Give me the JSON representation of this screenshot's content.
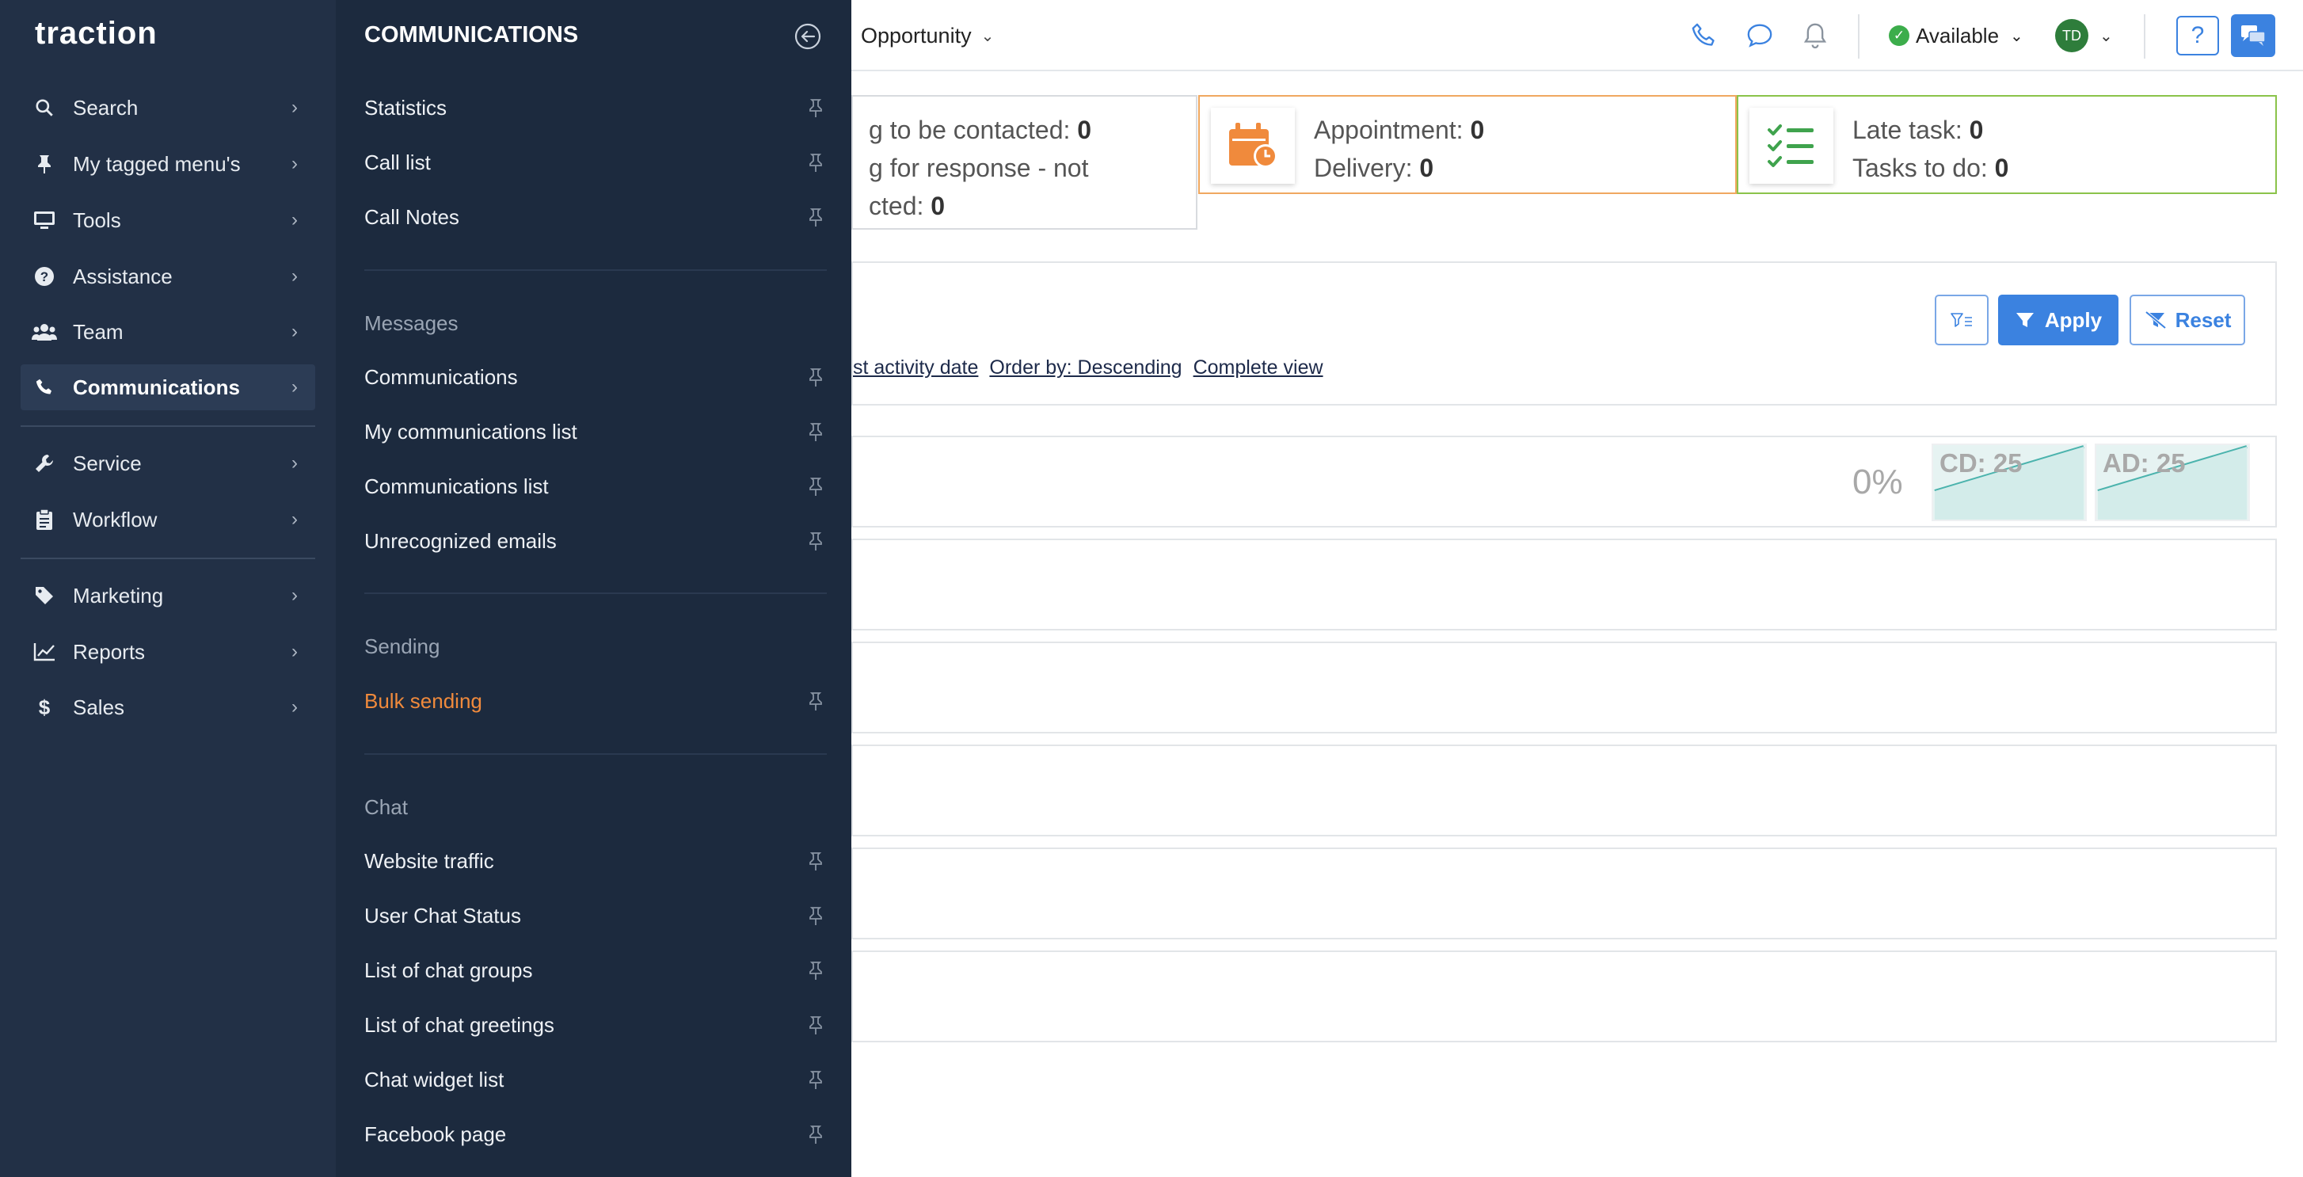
{
  "brand": {
    "logo_text": "traction"
  },
  "topbar": {
    "opportunity_label": "Opportunity",
    "status_label": "Available",
    "user_initials": "TD",
    "help_label": "?"
  },
  "kpis": {
    "contacted": {
      "line1": "g to be contacted: ",
      "line1_val": "0",
      "line2": "g for response - not",
      "line3": "cted: ",
      "line3_val": "0"
    },
    "appointment": {
      "label1": "Appointment: ",
      "val1": "0",
      "label2": "Delivery: ",
      "val2": "0"
    },
    "tasks": {
      "label1": "Late task: ",
      "val1": "0",
      "label2": "Tasks to do: ",
      "val2": "0"
    }
  },
  "filters": {
    "apply_label": "Apply",
    "reset_label": "Reset",
    "links": [
      "st activity date",
      "Order by: Descending",
      "Complete view"
    ]
  },
  "progress": {
    "percent_text": "0%",
    "cd_label": "CD: 25",
    "ad_label": "AD: 25"
  },
  "leftnav": {
    "items": [
      {
        "label": "Search",
        "icon": "search-icon"
      },
      {
        "label": "My tagged menu's",
        "icon": "pin-icon"
      },
      {
        "label": "Tools",
        "icon": "monitor-icon"
      },
      {
        "label": "Assistance",
        "icon": "question-circle-icon"
      },
      {
        "label": "Team",
        "icon": "users-icon"
      },
      {
        "label": "Communications",
        "icon": "phone-icon",
        "active": true
      },
      {
        "label": "Service",
        "icon": "wrench-icon"
      },
      {
        "label": "Workflow",
        "icon": "clipboard-icon"
      },
      {
        "label": "Marketing",
        "icon": "tag-icon"
      },
      {
        "label": "Reports",
        "icon": "chart-icon"
      },
      {
        "label": "Sales",
        "icon": "dollar-icon"
      }
    ]
  },
  "submenu": {
    "title": "COMMUNICATIONS",
    "group0": [
      "Statistics",
      "Call list",
      "Call Notes"
    ],
    "messages_heading": "Messages",
    "messages": [
      "Communications",
      "My communications list",
      "Communications list",
      "Unrecognized emails"
    ],
    "sending_heading": "Sending",
    "sending": [
      "Bulk sending"
    ],
    "chat_heading": "Chat",
    "chat": [
      "Website traffic",
      "User Chat Status",
      "List of chat groups",
      "List of chat greetings",
      "Chat widget list",
      "Facebook page"
    ]
  },
  "colors": {
    "accent": "#3b82e0",
    "highlight": "#f08a3c",
    "nav_bg": "#223046",
    "submenu_bg": "#1c2a3e"
  }
}
